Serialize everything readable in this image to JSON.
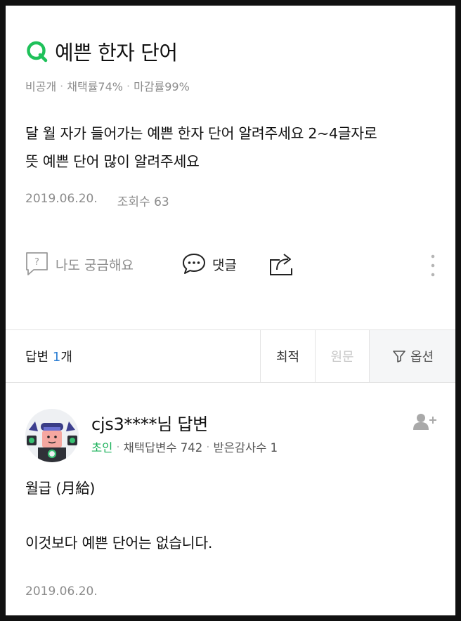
{
  "question": {
    "title": "예쁜 한자 단어",
    "meta": {
      "privacy": "비공개",
      "adoption_rate": "채택률74%",
      "closing_rate": "마감률99%"
    },
    "body_lines": [
      "달 월 자가 들어가는 예쁜 한자 단어 알려주세요 2~4글자로",
      "뜻 예쁜 단어 많이 알려주세요"
    ],
    "date": "2019.06.20.",
    "views": "조회수 63"
  },
  "actions": {
    "curious_label": "나도 궁금해요",
    "comment_label": "댓글",
    "icons": [
      "question-box-icon",
      "speech-bubble-icon",
      "share-icon",
      "more-vertical-icon"
    ]
  },
  "answers_bar": {
    "label": "답변",
    "count": "1",
    "unit": "개",
    "sort_latest": "최적",
    "sort_original": "원문",
    "options": "옵션"
  },
  "answer": {
    "author": "cjs3****님 답변",
    "rank": "초인",
    "adopted_count": "채택답변수 742",
    "thanks_count": "받은감사수 1",
    "body_lines": [
      "월급 (月給)",
      "이것보다 예쁜 단어는 없습니다."
    ],
    "date": "2019.06.20."
  },
  "colors": {
    "brand_green": "#1fc15a",
    "rank_green": "#1bb15a",
    "count_blue": "#2e7fd3",
    "muted_gray": "#8c8c8c"
  }
}
